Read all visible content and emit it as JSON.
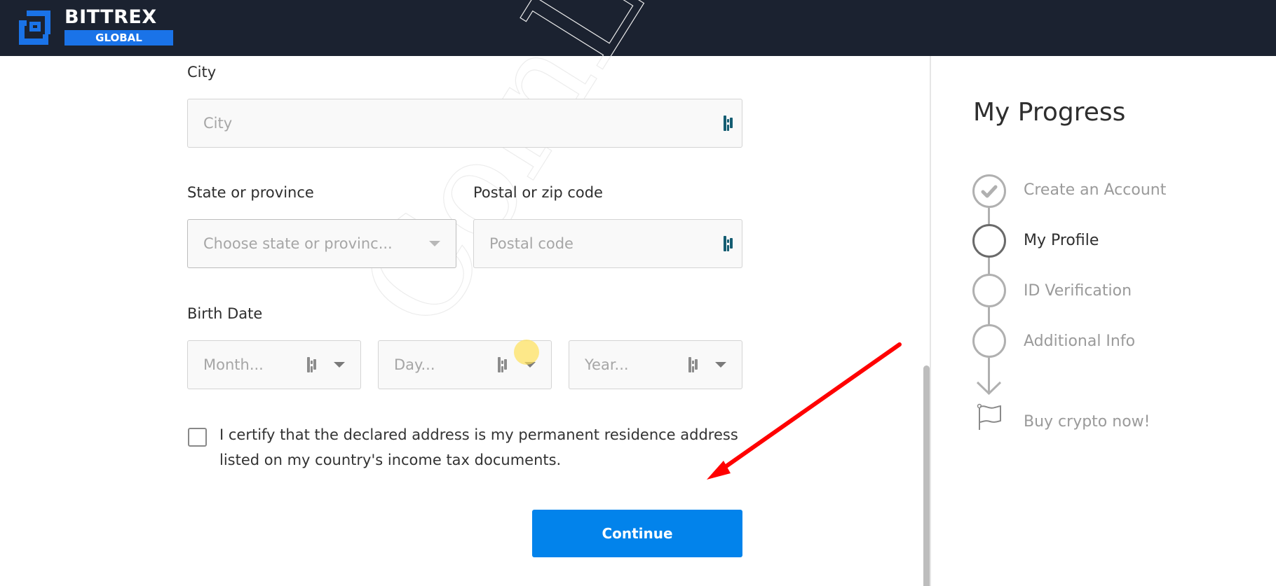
{
  "header": {
    "logo_name": "BITTREX",
    "logo_region": "GLOBAL",
    "brand_color": "#1a73e8",
    "background_color": "#1b2230"
  },
  "form": {
    "city": {
      "label": "City",
      "placeholder": "City",
      "value": ""
    },
    "state": {
      "label": "State or province",
      "placeholder": "Choose state or provinc...",
      "value": ""
    },
    "postal": {
      "label": "Postal or zip code",
      "placeholder": "Postal code",
      "value": ""
    },
    "birth_date": {
      "label": "Birth Date",
      "month_placeholder": "Month...",
      "day_placeholder": "Day...",
      "year_placeholder": "Year..."
    },
    "certify": {
      "checked": false,
      "text": "I certify that the declared address is my permanent residence address listed on my country's income tax documents."
    },
    "continue_label": "Continue",
    "continue_color": "#0283eb"
  },
  "watermark": "CoinLore",
  "progress": {
    "title": "My Progress",
    "steps": [
      {
        "label": "Create an Account",
        "status": "completed",
        "icon": "check-icon"
      },
      {
        "label": "My Profile",
        "status": "current",
        "icon": "circle-icon"
      },
      {
        "label": "ID Verification",
        "status": "pending",
        "icon": "circle-icon"
      },
      {
        "label": "Additional Info",
        "status": "pending",
        "icon": "circle-icon"
      }
    ],
    "final": {
      "label": "Buy crypto now!",
      "icon": "flag-icon"
    }
  },
  "annotation": {
    "type": "arrow",
    "color": "#ff0000",
    "points_to": "continue-button"
  }
}
